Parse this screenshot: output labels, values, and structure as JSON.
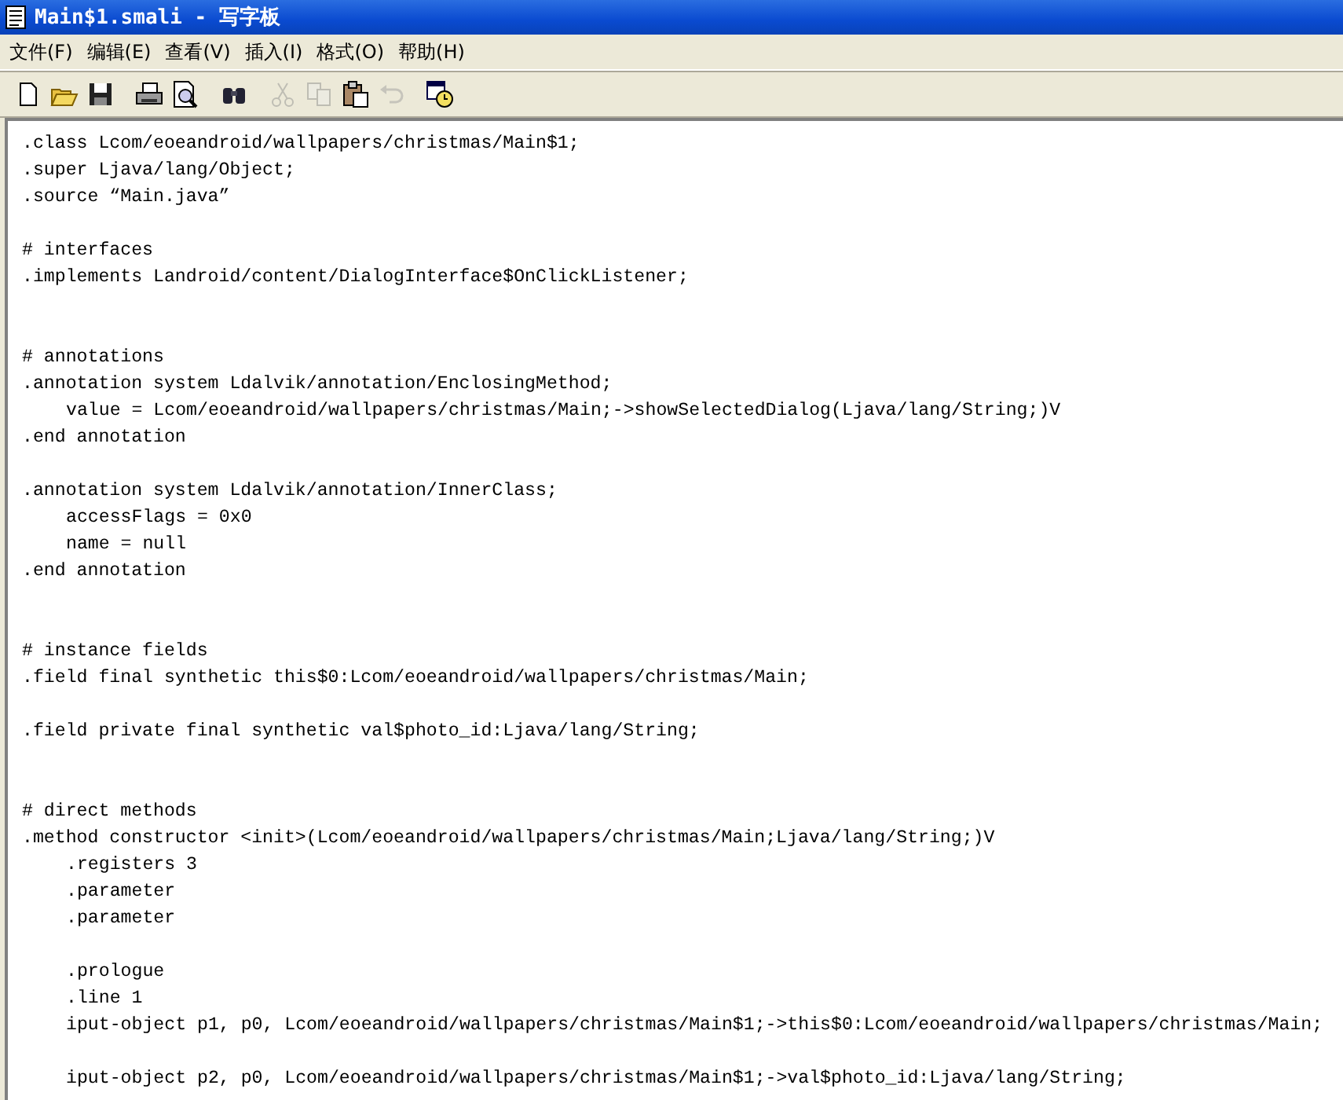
{
  "window": {
    "title": "Main$1.smali - 写字板"
  },
  "menu": [
    "文件(F)",
    "编辑(E)",
    "查看(V)",
    "插入(I)",
    "格式(O)",
    "帮助(H)"
  ],
  "toolbar": [
    {
      "kind": "new",
      "disabled": false
    },
    {
      "kind": "open",
      "disabled": false
    },
    {
      "kind": "save",
      "disabled": false
    },
    {
      "kind": "sep"
    },
    {
      "kind": "print",
      "disabled": false
    },
    {
      "kind": "preview",
      "disabled": false
    },
    {
      "kind": "sep"
    },
    {
      "kind": "find",
      "disabled": false
    },
    {
      "kind": "sep"
    },
    {
      "kind": "cut",
      "disabled": true
    },
    {
      "kind": "copy",
      "disabled": true
    },
    {
      "kind": "paste",
      "disabled": false
    },
    {
      "kind": "undo",
      "disabled": true
    },
    {
      "kind": "sep"
    },
    {
      "kind": "datetime",
      "disabled": false
    }
  ],
  "document": {
    "lines": [
      {
        "kind": "top",
        "text": ".class Lcom/eoeandroid/wallpapers/christmas/Main$1;"
      },
      {
        "kind": "top",
        "text": ".super Ljava/lang/Object;"
      },
      {
        "kind": "top",
        "text": ".source “Main.java”"
      },
      {
        "kind": "blank"
      },
      {
        "kind": "top",
        "text": "# interfaces"
      },
      {
        "kind": "top",
        "text": ".implements Landroid/content/DialogInterface$OnClickListener;"
      },
      {
        "kind": "blank"
      },
      {
        "kind": "blank"
      },
      {
        "kind": "top",
        "text": "# annotations"
      },
      {
        "kind": "top",
        "text": ".annotation system Ldalvik/annotation/EnclosingMethod;"
      },
      {
        "kind": "nested",
        "text": "value = Lcom/eoeandroid/wallpapers/christmas/Main;->showSelectedDialog(Ljava/lang/String;)V"
      },
      {
        "kind": "top",
        "text": ".end annotation"
      },
      {
        "kind": "blank"
      },
      {
        "kind": "top",
        "text": ".annotation system Ldalvik/annotation/InnerClass;"
      },
      {
        "kind": "nested",
        "text": "accessFlags = 0x0"
      },
      {
        "kind": "nested",
        "text": "name = null"
      },
      {
        "kind": "top",
        "text": ".end annotation"
      },
      {
        "kind": "blank"
      },
      {
        "kind": "blank"
      },
      {
        "kind": "top",
        "text": "# instance fields"
      },
      {
        "kind": "top",
        "text": ".field final synthetic this$0:Lcom/eoeandroid/wallpapers/christmas/Main;"
      },
      {
        "kind": "blank"
      },
      {
        "kind": "top",
        "text": ".field private final synthetic val$photo_id:Ljava/lang/String;"
      },
      {
        "kind": "blank"
      },
      {
        "kind": "blank"
      },
      {
        "kind": "top",
        "text": "# direct methods"
      },
      {
        "kind": "top",
        "text": ".method constructor <init>(Lcom/eoeandroid/wallpapers/christmas/Main;Ljava/lang/String;)V"
      },
      {
        "kind": "nested",
        "text": ".registers 3"
      },
      {
        "kind": "nested",
        "text": ".parameter"
      },
      {
        "kind": "nested",
        "text": ".parameter"
      },
      {
        "kind": "blank"
      },
      {
        "kind": "nested",
        "text": ".prologue"
      },
      {
        "kind": "nested",
        "text": ".line 1"
      },
      {
        "kind": "nested",
        "text": "iput-object p1, p0, Lcom/eoeandroid/wallpapers/christmas/Main$1;->this$0:Lcom/eoeandroid/wallpapers/christmas/Main;"
      },
      {
        "kind": "blank"
      },
      {
        "kind": "nested",
        "text": "iput-object p2, p0, Lcom/eoeandroid/wallpapers/christmas/Main$1;->val$photo_id:Ljava/lang/String;"
      }
    ]
  }
}
